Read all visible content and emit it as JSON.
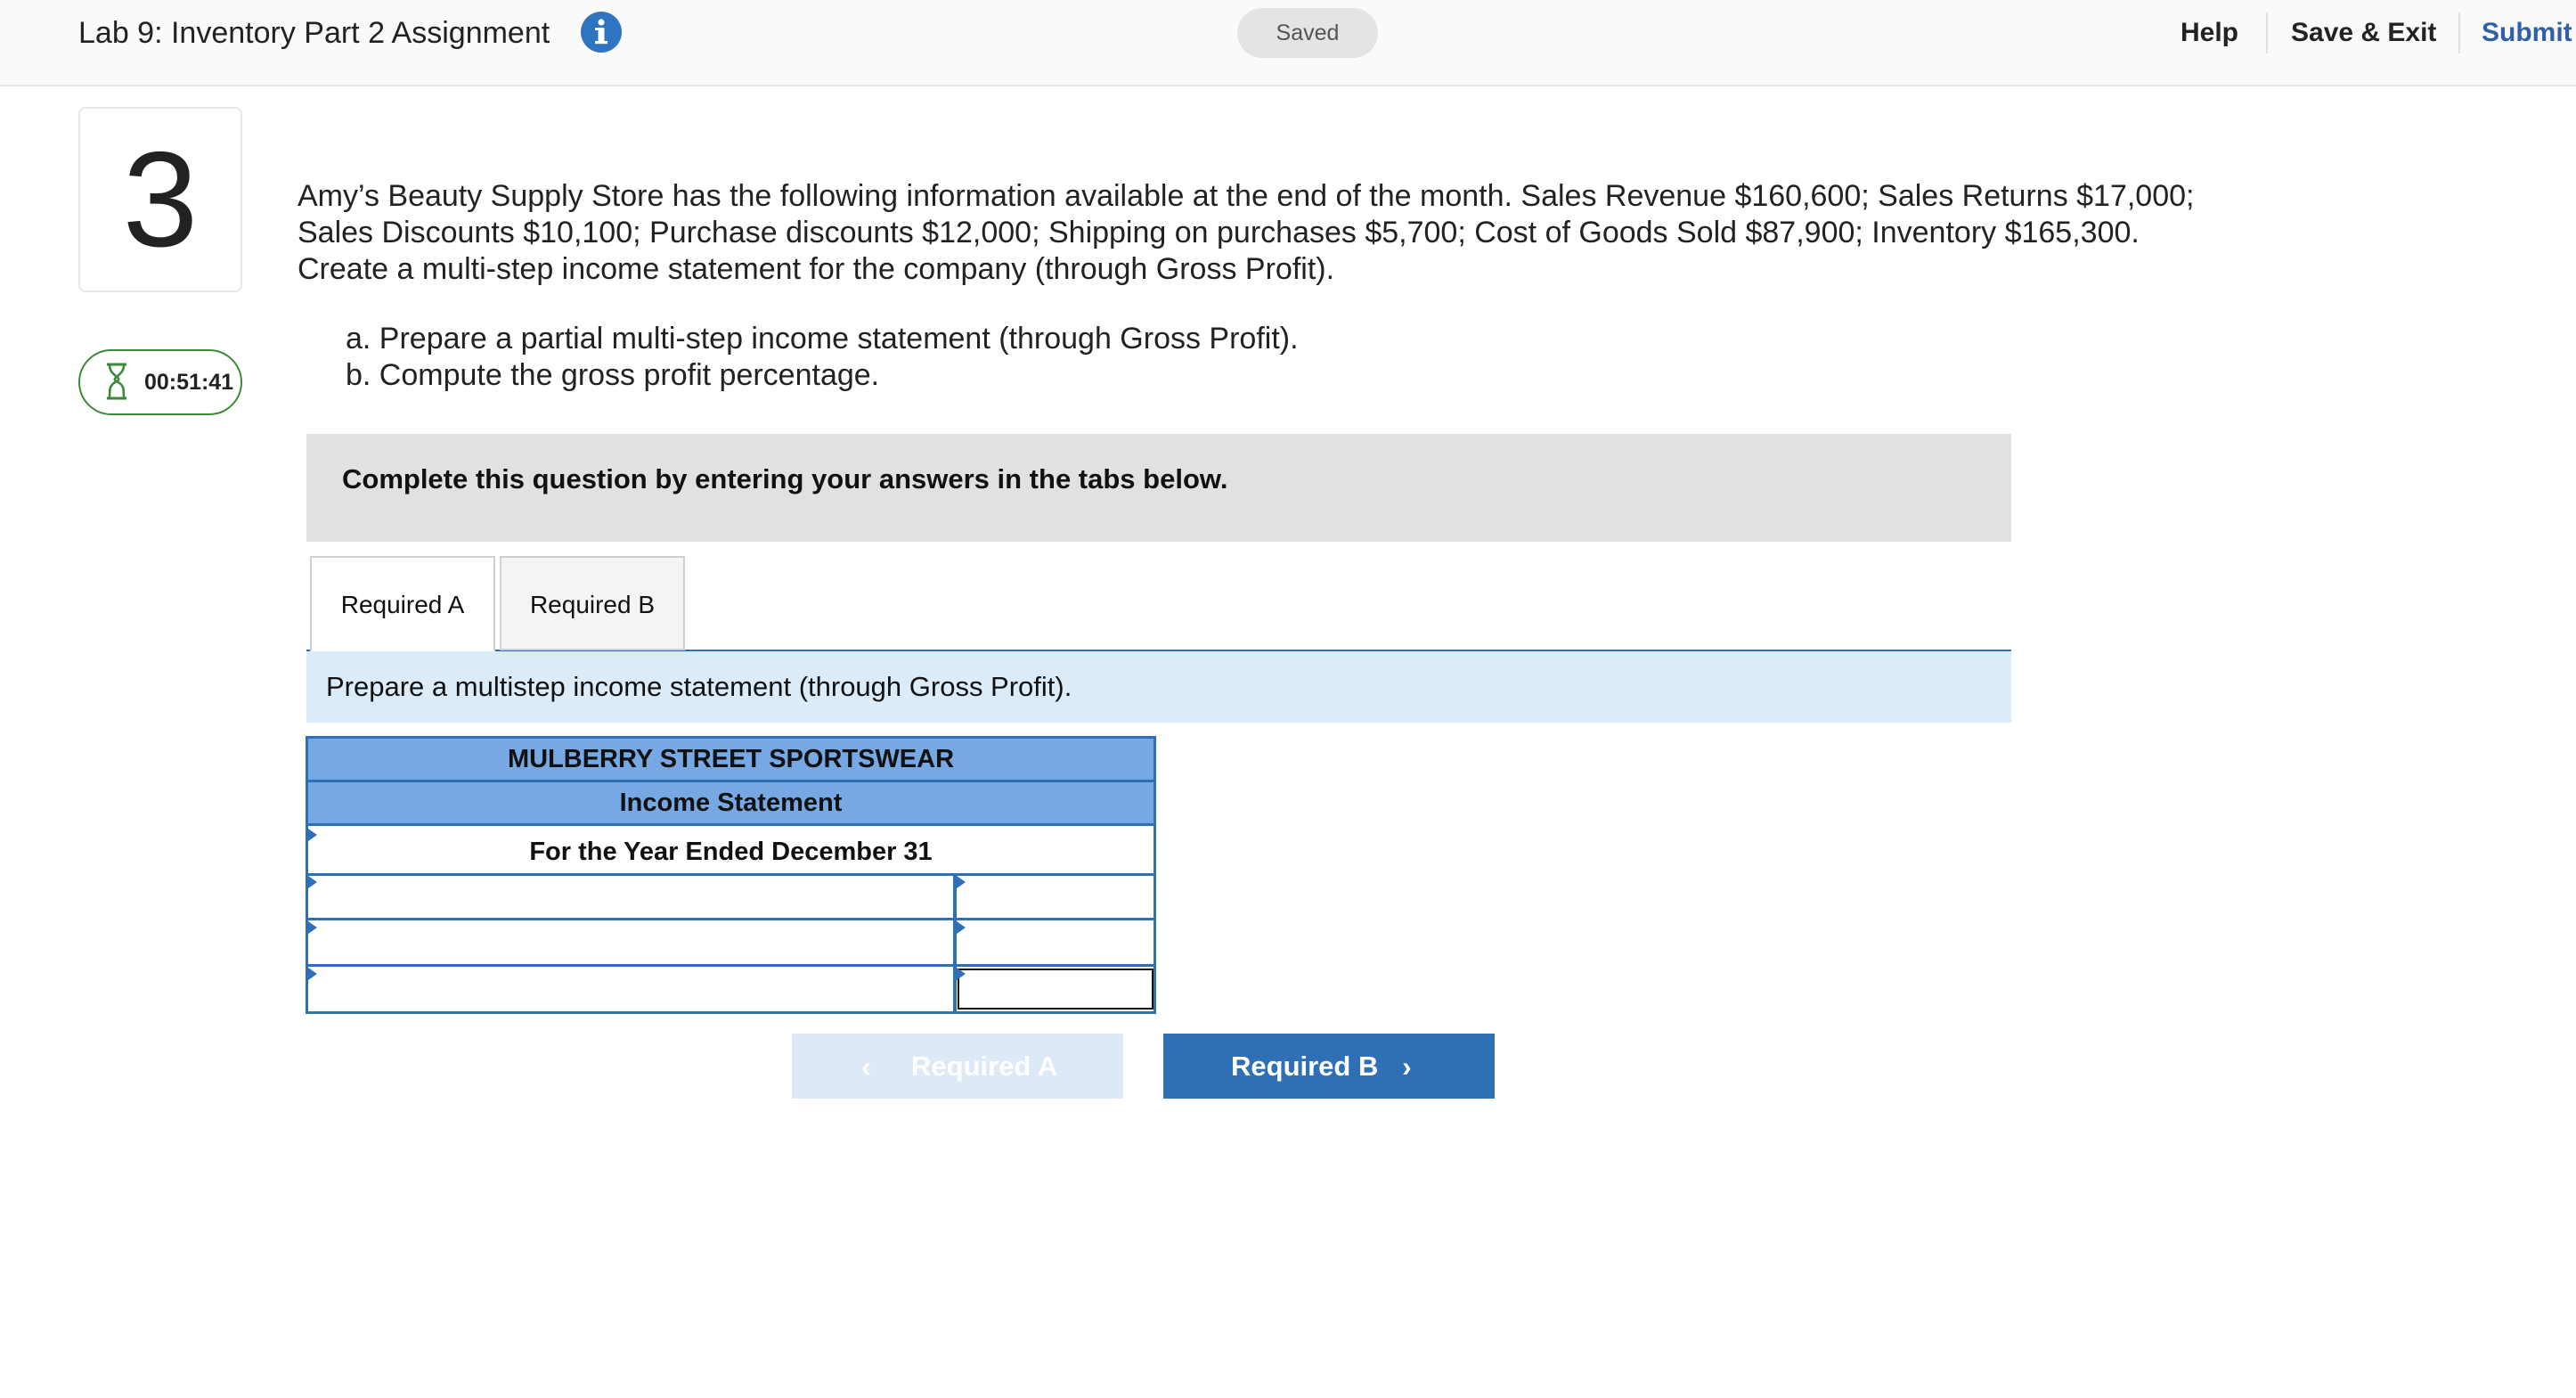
{
  "header": {
    "title": "Lab 9: Inventory Part 2 Assignment",
    "info_icon": "info-icon",
    "saved_label": "Saved",
    "help_label": "Help",
    "save_exit_label": "Save & Exit",
    "submit_label": "Submit"
  },
  "question": {
    "number": "3",
    "timer": "00:51:41",
    "timer_icon": "hourglass-icon",
    "text": "Amy’s Beauty Supply Store has the following information available at the end of the month. Sales Revenue $160,600; Sales Returns $17,000; Sales Discounts $10,100; Purchase discounts $12,000; Shipping on purchases $5,700; Cost of Goods Sold $87,900; Inventory $165,300. Create a multi-step income statement for the company (through Gross Profit).",
    "items": [
      "a. Prepare a partial multi-step income statement (through Gross Profit).",
      "b. Compute the gross profit percentage."
    ],
    "instruction": "Complete this question by entering your answers in the tabs below."
  },
  "tabs": [
    {
      "label": "Required A",
      "active": true
    },
    {
      "label": "Required B",
      "active": false
    }
  ],
  "panel": {
    "prompt": "Prepare a multistep income statement (through Gross Profit).",
    "table": {
      "company": "MULBERRY STREET SPORTSWEAR",
      "statement": "Income Statement",
      "period": "For the Year Ended December 31",
      "rows": [
        {
          "label": "",
          "amount": ""
        },
        {
          "label": "",
          "amount": ""
        },
        {
          "label": "",
          "amount": ""
        }
      ]
    }
  },
  "nav": {
    "prev_label": "Required A",
    "next_label": "Required B",
    "prev_enabled": false,
    "next_enabled": true
  },
  "colors": {
    "accent": "#2f6fb5",
    "table_header": "#76a9e3",
    "instruction_bg": "#dcebf8",
    "timer_border": "#3a8a3a"
  }
}
